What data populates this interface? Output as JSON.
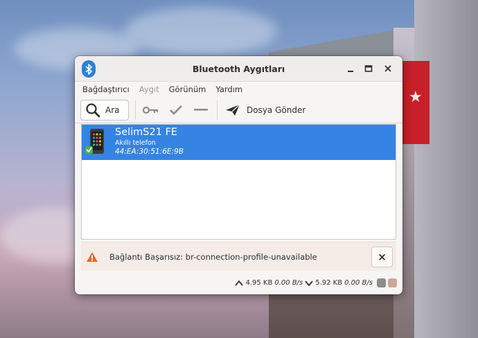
{
  "window": {
    "title": "Bluetooth Aygıtları"
  },
  "menu": {
    "items": [
      {
        "label": "Bağdaştırıcı",
        "enabled": true
      },
      {
        "label": "Aygıt",
        "enabled": false
      },
      {
        "label": "Görünüm",
        "enabled": true
      },
      {
        "label": "Yardım",
        "enabled": true
      }
    ]
  },
  "toolbar": {
    "search_label": "Ara",
    "send_label": "Dosya Gönder",
    "icons": [
      "search-icon",
      "key-icon",
      "check-icon",
      "dash-icon",
      "paper-plane-icon"
    ]
  },
  "device": {
    "name": "SelimS21 FE",
    "type": "Akıllı telefon",
    "mac": "44:EA:30:51:6E:9B",
    "connected": true,
    "selected": true
  },
  "infobar": {
    "message": "Bağlantı Başarısız: br-connection-profile-unavailable",
    "close_symbol": "×"
  },
  "status": {
    "download_total": "4.95 KB",
    "download_rate": "0.00 B/s",
    "upload_total": "5.92 KB",
    "upload_rate": "0.00 B/s"
  },
  "colors": {
    "selection": "#3584e4",
    "bluetooth_icon": "#2f7fd6",
    "infobar_bg": "#f4ece6",
    "warning": "#e06d2a"
  }
}
